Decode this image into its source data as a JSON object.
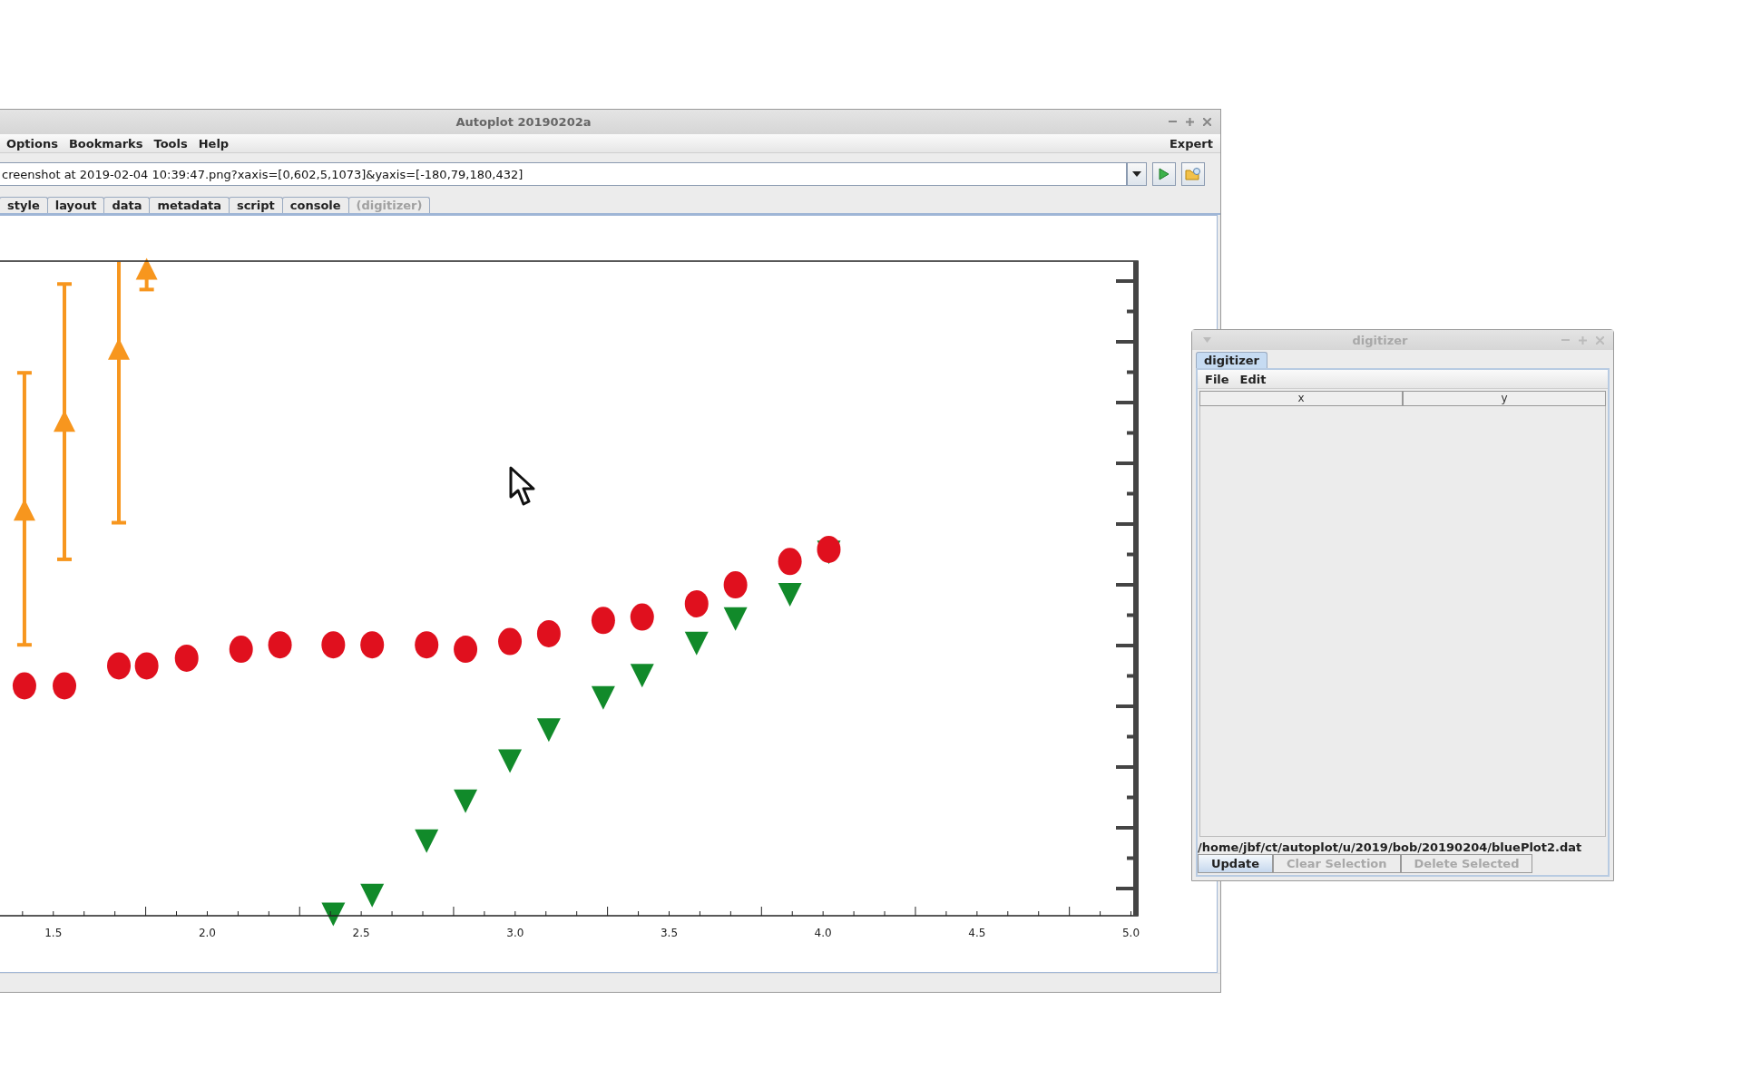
{
  "autoplot_window": {
    "title": "Autoplot 20190202a",
    "menus": [
      {
        "label": "Options"
      },
      {
        "label": "Bookmarks"
      },
      {
        "label": "Tools"
      },
      {
        "label": "Help"
      }
    ],
    "expert_menu": "Expert",
    "address_field": {
      "value": "creenshot at 2019-02-04 10:39:47.png?xaxis=[0,602,5,1073]&yaxis=[-180,79,180,432]"
    },
    "tabs": [
      {
        "label": "style",
        "disabled": false
      },
      {
        "label": "layout",
        "disabled": false
      },
      {
        "label": "data",
        "disabled": false
      },
      {
        "label": "metadata",
        "disabled": false
      },
      {
        "label": "script",
        "disabled": false
      },
      {
        "label": "console",
        "disabled": false
      },
      {
        "label": "(digitizer)",
        "disabled": true
      }
    ],
    "x_tick_labels": [
      "1.5",
      "2.0",
      "2.5",
      "3.0",
      "3.5",
      "4.0",
      "4.5",
      "5.0"
    ]
  },
  "digitizer_window": {
    "title": "digitizer",
    "tabs": [
      {
        "label": "digitizer",
        "selected": true
      }
    ],
    "menus": [
      {
        "label": "File"
      },
      {
        "label": "Edit"
      }
    ],
    "table": {
      "columns": [
        "x",
        "y"
      ]
    },
    "file_path": "/home/jbf/ct/autoplot/u/2019/bob/20190204/bluePlot2.dat",
    "buttons": [
      {
        "label": "Update",
        "disabled": false
      },
      {
        "label": "Clear Selection",
        "disabled": true
      },
      {
        "label": "Delete Selected",
        "disabled": true
      }
    ]
  }
}
